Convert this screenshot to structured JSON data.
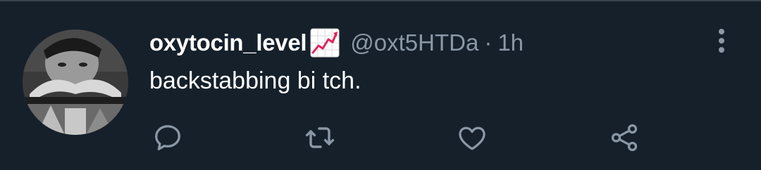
{
  "tweet": {
    "display_name": "oxytocin_level",
    "name_emoji": "chart-increasing-emoji",
    "handle": "@oxt5HTDa",
    "separator": "·",
    "timestamp": "1h",
    "text": "backstabbing bi tch."
  },
  "actions": [
    {
      "name": "reply",
      "icon": "comment-icon"
    },
    {
      "name": "retweet",
      "icon": "retweet-icon"
    },
    {
      "name": "like",
      "icon": "heart-icon"
    },
    {
      "name": "share",
      "icon": "share-icon"
    }
  ],
  "colors": {
    "background": "#15202b",
    "text_primary": "#ffffff",
    "text_secondary": "#8b98a5",
    "icon": "#8b98a5",
    "divider": "#38444d"
  }
}
